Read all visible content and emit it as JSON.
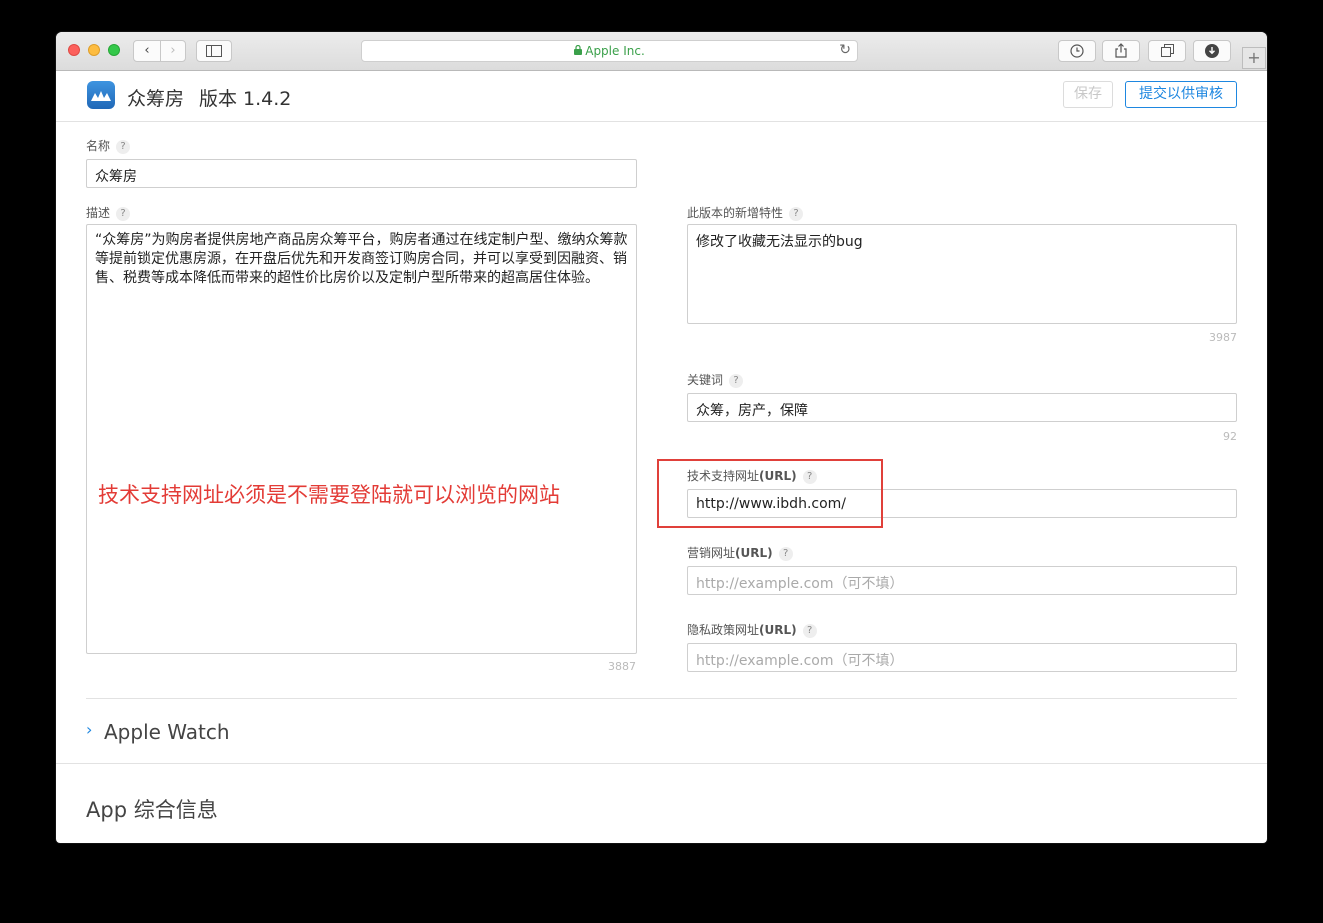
{
  "browser": {
    "address_text": "Apple Inc.",
    "lock_icon": "lock-icon",
    "reload_icon": "reload-icon",
    "back_icon": "‹",
    "forward_icon": "›",
    "newtab_label": "+"
  },
  "header": {
    "app_name": "众筹房",
    "version_label": "版本 1.4.2",
    "save_label": "保存",
    "submit_label": "提交以供审核"
  },
  "form": {
    "name": {
      "label": "名称",
      "value": "众筹房"
    },
    "description": {
      "label": "描述",
      "value": "“众筹房”为购房者提供房地产商品房众筹平台，购房者通过在线定制户型、缴纳众筹款等提前锁定优惠房源，在开盘后优先和开发商签订购房合同，并可以享受到因融资、销售、税费等成本降低而带来的超性价比房价以及定制户型所带来的超高居住体验。",
      "counter": "3887"
    },
    "whats_new": {
      "label": "此版本的新增特性",
      "value": "修改了收藏无法显示的bug",
      "counter": "3987"
    },
    "keywords": {
      "label": "关键词",
      "value": "众筹，房产，保障",
      "counter": "92"
    },
    "support_url": {
      "label": "技术支持网址",
      "label_suffix": "(URL)",
      "value": "http://www.ibdh.com/"
    },
    "marketing_url": {
      "label": "营销网址",
      "label_suffix": "(URL)",
      "placeholder": "http://example.com（可不填）"
    },
    "privacy_url": {
      "label": "隐私政策网址",
      "label_suffix": "(URL)",
      "placeholder": "http://example.com（可不填）"
    },
    "help_glyph": "?"
  },
  "annotation": {
    "text": "技术支持网址必须是不需要登陆就可以浏览的网站",
    "color": "#e33b36"
  },
  "sections": {
    "apple_watch": "Apple Watch",
    "app_info": "App 综合信息"
  },
  "colors": {
    "accent": "#1e87e0",
    "secure": "#3aa04a"
  }
}
